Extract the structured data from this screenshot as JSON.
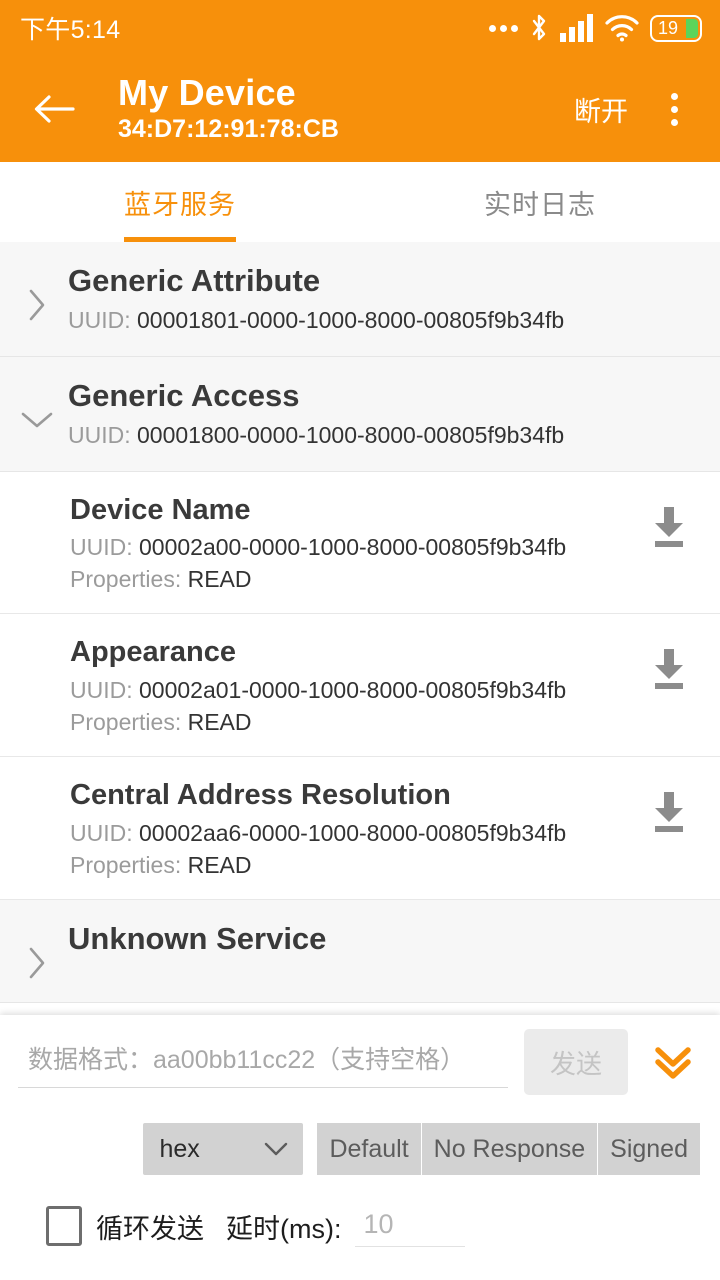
{
  "theme": {
    "accent": "#F7900B",
    "list_bg": "#F7F7F7",
    "text": "#3a3a3a",
    "muted": "#9b9b9b"
  },
  "statusbar": {
    "time": "下午5:14",
    "icons": [
      "more-dots-icon",
      "bluetooth-icon",
      "cellular-signal-icon",
      "wifi-icon",
      "battery-icon"
    ],
    "battery_level": "19"
  },
  "appbar": {
    "back_icon": "arrow-left-icon",
    "title": "My Device",
    "subtitle": "34:D7:12:91:78:CB",
    "action_label": "断开",
    "overflow_icon": "overflow-menu-icon"
  },
  "tabs": [
    {
      "label": "蓝牙服务",
      "active": true
    },
    {
      "label": "实时日志",
      "active": false
    }
  ],
  "uuid_key": "UUID:",
  "props_key": "Properties:",
  "services": [
    {
      "name": "Generic Attribute",
      "uuid": "00001801-0000-1000-8000-00805f9b34fb",
      "expanded": false,
      "chevron": "chevron-right-icon",
      "characteristics": []
    },
    {
      "name": "Generic Access",
      "uuid": "00001800-0000-1000-8000-00805f9b34fb",
      "expanded": true,
      "chevron": "chevron-down-icon",
      "characteristics": [
        {
          "name": "Device Name",
          "uuid": "00002a00-0000-1000-8000-00805f9b34fb",
          "properties": "READ",
          "action_icon": "download-read-icon"
        },
        {
          "name": "Appearance",
          "uuid": "00002a01-0000-1000-8000-00805f9b34fb",
          "properties": "READ",
          "action_icon": "download-read-icon"
        },
        {
          "name": "Central Address Resolution",
          "uuid": "00002aa6-0000-1000-8000-00805f9b34fb",
          "properties": "READ",
          "action_icon": "download-read-icon"
        }
      ]
    },
    {
      "name": "Unknown Service",
      "uuid": "",
      "expanded": false,
      "chevron": "chevron-right-icon",
      "characteristics": []
    }
  ],
  "sheet": {
    "data_input": {
      "value": "",
      "placeholder": "数据格式：aa00bb11cc22（支持空格）"
    },
    "send_label": "发送",
    "collapse_icon": "double-chevron-down-icon",
    "format_select": {
      "value": "hex",
      "caret_icon": "chevron-down-icon"
    },
    "write_modes": [
      "Default",
      "No Response",
      "Signed"
    ],
    "loop_checkbox": {
      "label": "循环发送",
      "checked": false
    },
    "delay_label": "延时(ms):",
    "delay_input": {
      "value": "",
      "placeholder": "10"
    }
  }
}
